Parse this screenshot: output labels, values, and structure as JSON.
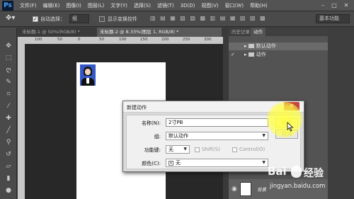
{
  "app": {
    "logo": "Ps"
  },
  "menubar": {
    "items": [
      "文件(F)",
      "编辑(E)",
      "图像(I)",
      "图层(L)",
      "文字(Y)",
      "选择(S)",
      "滤镜(T)",
      "3D(D)",
      "视图(V)",
      "窗口(W)",
      "帮助(H)"
    ],
    "minimize": "–",
    "maximize": "□",
    "close": "✕"
  },
  "options": {
    "auto_select_label": "自动选择：",
    "auto_select_value": "组",
    "show_transform_label": "显示变换控件",
    "workspace": "基本功能"
  },
  "tabs": [
    {
      "label": "未标题-1 @ 50%(RGB/8) *"
    },
    {
      "label": "未标题-2 @ 8.33%(图层 1, RGB/8) *"
    }
  ],
  "ruler": {
    "marks": [
      "100",
      "50",
      "0",
      "50",
      "100",
      "150",
      "200",
      "250",
      "300"
    ]
  },
  "panel": {
    "tabs": [
      "历史记录",
      "动作"
    ],
    "actions": [
      {
        "label": "默认动作"
      },
      {
        "label": "动作"
      }
    ],
    "layer_name": "背景"
  },
  "dialog": {
    "title": "新建动作",
    "close_label": "✕",
    "name_label": "名称(N):",
    "name_value": "2寸PB",
    "group_label": "组:",
    "group_value": "默认动作",
    "fkey_label": "功能键:",
    "fkey_value": "无",
    "shift_label": "Shift(S)",
    "control_label": "Control(O)",
    "color_label": "颜色(C):",
    "color_value": "无",
    "record_button": "记录",
    "cancel_button": "取消"
  },
  "watermark": {
    "logo": "Bai",
    "jy": "经验",
    "url": "jingyan.baidu.com"
  }
}
